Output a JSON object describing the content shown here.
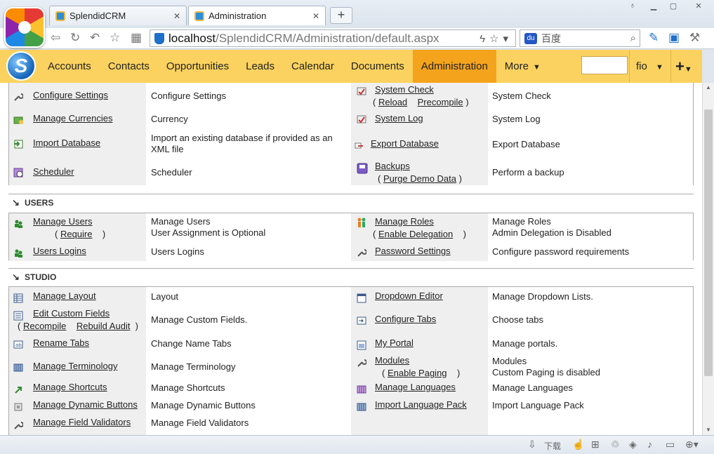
{
  "browser": {
    "tabs": [
      {
        "title": "SplendidCRM"
      },
      {
        "title": "Administration"
      }
    ],
    "new_tab": "+",
    "close_glyph": "✕",
    "address_host": "localhost",
    "address_path": "/SplendidCRM/Administration/default.aspx",
    "search_engine": "百度",
    "status_download": "下载"
  },
  "app": {
    "menu": [
      {
        "label": "Accounts"
      },
      {
        "label": "Contacts"
      },
      {
        "label": "Opportunities"
      },
      {
        "label": "Leads"
      },
      {
        "label": "Calendar"
      },
      {
        "label": "Documents"
      },
      {
        "label": "Administration",
        "active": true
      },
      {
        "label": "More"
      }
    ],
    "user": "fio",
    "plus": "+"
  },
  "system": {
    "configure_settings": {
      "link": "Configure Settings",
      "desc": "Configure Settings"
    },
    "system_check": {
      "link": "System Check",
      "reload": "Reload",
      "precompile": "Precompile",
      "desc": "System Check"
    },
    "manage_currencies": {
      "link": "Manage Currencies",
      "desc": "Currency"
    },
    "system_log": {
      "link": "System Log",
      "desc": "System Log"
    },
    "import_database": {
      "link": "Import Database",
      "desc": "Import an existing database if provided as an XML file"
    },
    "export_database": {
      "link": "Export Database",
      "desc": "Export Database"
    },
    "scheduler": {
      "link": "Scheduler",
      "desc": "Scheduler"
    },
    "backups": {
      "link": "Backups",
      "purge": "Purge Demo Data",
      "desc": "Perform a backup"
    }
  },
  "users": {
    "header": "USERS",
    "manage_users": {
      "link": "Manage Users",
      "require": "Require",
      "desc1": "Manage Users",
      "desc2": "User Assignment is Optional"
    },
    "manage_roles": {
      "link": "Manage Roles",
      "enable": "Enable Delegation",
      "desc1": "Manage Roles",
      "desc2": "Admin Delegation is Disabled"
    },
    "users_logins": {
      "link": "Users Logins",
      "desc": "Users Logins"
    },
    "password_settings": {
      "link": "Password Settings",
      "desc": "Configure password requirements"
    }
  },
  "studio": {
    "header": "STUDIO",
    "manage_layout": {
      "link": "Manage Layout",
      "desc": "Layout"
    },
    "dropdown_editor": {
      "link": "Dropdown Editor",
      "desc": "Manage Dropdown Lists."
    },
    "edit_custom_fields": {
      "link": "Edit Custom Fields",
      "recompile": "Recompile",
      "rebuild": "Rebuild Audit",
      "desc": "Manage Custom Fields."
    },
    "configure_tabs": {
      "link": "Configure Tabs",
      "desc": "Choose tabs"
    },
    "rename_tabs": {
      "link": "Rename Tabs",
      "desc": "Change Name Tabs"
    },
    "my_portal": {
      "link": "My Portal",
      "desc": "Manage portals."
    },
    "manage_terminology": {
      "link": "Manage Terminology",
      "desc": "Manage Terminology"
    },
    "modules": {
      "link": "Modules",
      "enable": "Enable Paging",
      "desc1": "Modules",
      "desc2": "Custom Paging is disabled"
    },
    "manage_shortcuts": {
      "link": "Manage Shortcuts",
      "desc": "Manage Shortcuts"
    },
    "manage_languages": {
      "link": "Manage Languages",
      "desc": "Manage Languages"
    },
    "manage_dynamic_buttons": {
      "link": "Manage Dynamic Buttons",
      "desc": "Manage Dynamic Buttons"
    },
    "import_language_pack": {
      "link": "Import Language Pack",
      "desc": "Import Language Pack"
    },
    "manage_field_validators": {
      "link": "Manage Field Validators",
      "desc": "Manage Field Validators"
    }
  },
  "colors": {
    "header": "#fbd25f",
    "active_menu": "#f4a31c",
    "label_cell": "#efefef"
  }
}
